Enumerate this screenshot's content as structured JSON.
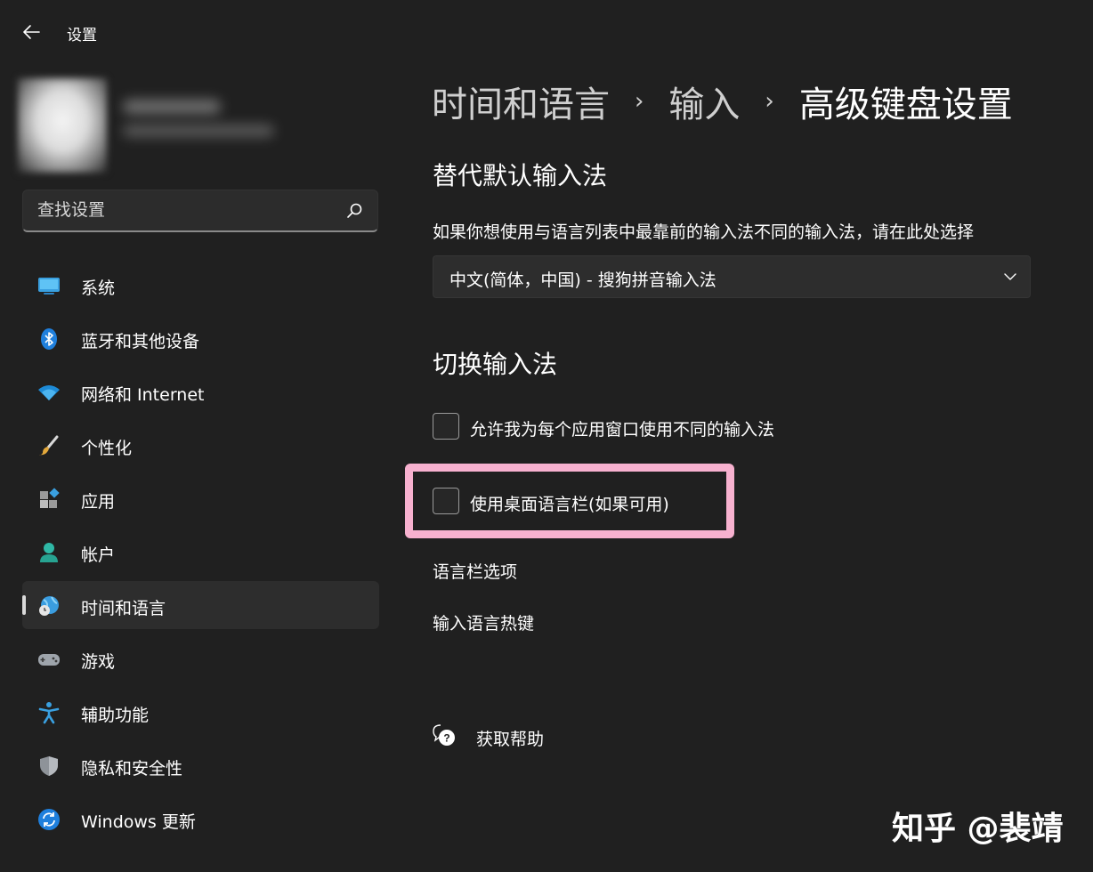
{
  "window": {
    "title": "设置"
  },
  "search": {
    "placeholder": "查找设置"
  },
  "sidebar": {
    "items": [
      {
        "label": "系统",
        "icon": "monitor-icon"
      },
      {
        "label": "蓝牙和其他设备",
        "icon": "bluetooth-icon"
      },
      {
        "label": "网络和 Internet",
        "icon": "wifi-icon"
      },
      {
        "label": "个性化",
        "icon": "brush-icon"
      },
      {
        "label": "应用",
        "icon": "apps-icon"
      },
      {
        "label": "帐户",
        "icon": "person-icon"
      },
      {
        "label": "时间和语言",
        "icon": "globe-clock-icon",
        "active": true
      },
      {
        "label": "游戏",
        "icon": "gamepad-icon"
      },
      {
        "label": "辅助功能",
        "icon": "accessibility-icon"
      },
      {
        "label": "隐私和安全性",
        "icon": "shield-icon"
      },
      {
        "label": "Windows 更新",
        "icon": "update-icon"
      }
    ]
  },
  "breadcrumb": {
    "items": [
      "时间和语言",
      "输入",
      "高级键盘设置"
    ],
    "separator": "›"
  },
  "override_section": {
    "title": "替代默认输入法",
    "description": "如果你想使用与语言列表中最靠前的输入法不同的输入法，请在此处选择",
    "dropdown_value": "中文(简体，中国) - 搜狗拼音输入法"
  },
  "switch_section": {
    "title": "切换输入法",
    "option1": {
      "label": "允许我为每个应用窗口使用不同的输入法",
      "checked": false
    },
    "option2": {
      "label": "使用桌面语言栏(如果可用)",
      "checked": false
    },
    "link1": "语言栏选项",
    "link2": "输入语言热键"
  },
  "help": {
    "label": "获取帮助"
  },
  "watermark": "知乎 @裴靖",
  "colors": {
    "background": "#202020",
    "highlight": "#f7b1cf",
    "accent": "#4cc2ff"
  }
}
